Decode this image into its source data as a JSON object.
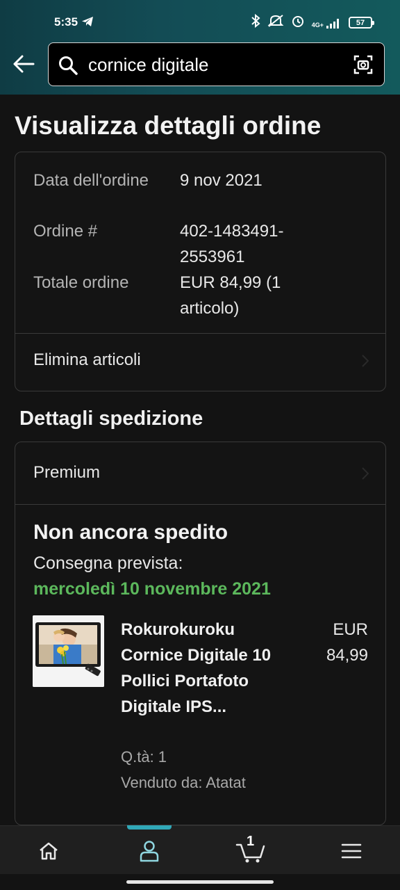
{
  "status_bar": {
    "time": "5:35",
    "network": "4G+",
    "battery": "57"
  },
  "search": {
    "value": "cornice digitale"
  },
  "page_title": "Visualizza dettagli ordine",
  "order_summary": {
    "date_label": "Data dell'ordine",
    "date_value": "9 nov 2021",
    "number_label": "Ordine #",
    "number_value": "402-1483491-2553961",
    "total_label": "Totale ordine",
    "total_value": "EUR 84,99 (1 articolo)",
    "delete_items": "Elimina articoli"
  },
  "shipping": {
    "section_title": "Dettagli spedizione",
    "method": "Premium",
    "status": "Non ancora spedito",
    "eta_label": "Consegna prevista:",
    "eta_date": "mercoledì 10 novembre 2021",
    "product": {
      "title": "Rokurokuroku Cornice Digitale 10 Pollici Portafoto Digitale IPS...",
      "price": "EUR 84,99",
      "quantity": "Q.tà: 1",
      "seller": "Venduto da: Atatat"
    }
  },
  "bottom_nav": {
    "cart_count": "1",
    "items": [
      "home-icon",
      "account-icon",
      "cart-icon",
      "menu-icon"
    ],
    "active_item": "account-icon"
  },
  "colors": {
    "accent_teal": "#30a8b8",
    "delivery_green": "#5cb85c",
    "background": "#131313"
  }
}
